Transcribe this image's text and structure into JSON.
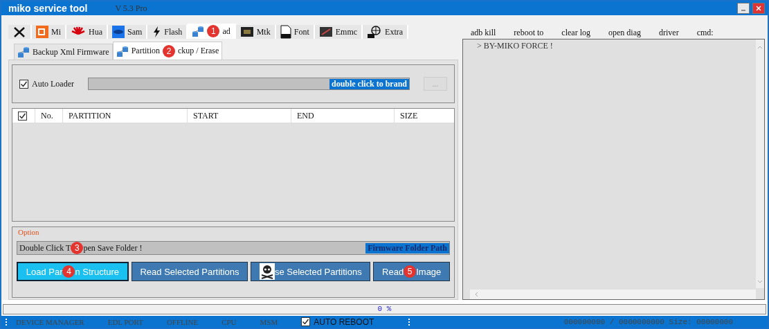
{
  "window": {
    "title": "miko service tool",
    "version": "V 5.3 Pro"
  },
  "main_tabs": [
    {
      "selected": false
    },
    {
      "parts": [
        {
          "text": "Mi"
        }
      ],
      "selected": false
    },
    {
      "parts": [
        {
          "text": "Hua"
        }
      ],
      "selected": false
    },
    {
      "parts": [
        {
          "text": "Sam"
        }
      ],
      "selected": false
    },
    {
      "parts": [
        {
          "text": "Flash"
        }
      ],
      "selected": false
    },
    {
      "parts": [
        {
          "marker": "1"
        },
        {
          "text": "ad"
        }
      ],
      "selected": true
    },
    {
      "parts": [
        {
          "text": "Mtk"
        }
      ],
      "selected": false
    },
    {
      "parts": [
        {
          "text": "Font"
        }
      ],
      "selected": false
    },
    {
      "parts": [
        {
          "text": "Emmc"
        }
      ],
      "selected": false
    },
    {
      "parts": [
        {
          "text": "Extra"
        }
      ],
      "selected": false
    }
  ],
  "sub_tabs": [
    {
      "parts": [
        {
          "text": "Backup Xml Firmware"
        }
      ],
      "selected": false
    },
    {
      "parts": [
        {
          "text": "Partition"
        },
        {
          "marker": "2"
        },
        {
          "text": "ckup / Erase"
        }
      ],
      "selected": true
    }
  ],
  "loader": {
    "label": "Auto Loader",
    "checked": true,
    "hint": "double click to brand",
    "browse": "...",
    "browse_disabled": true
  },
  "table": {
    "header_checked": true,
    "columns": [
      "No.",
      "PARTITION",
      "START",
      "END",
      "SIZE"
    ]
  },
  "option": {
    "legend": "Option",
    "path_parts": [
      {
        "text": "Double Click T"
      },
      {
        "marker": "3"
      },
      {
        "text": "pen Save Folder !"
      }
    ],
    "path_hint": "Firmware Folder Path"
  },
  "buttons": [
    {
      "parts": [
        {
          "text": "Load Par"
        },
        {
          "marker": "4"
        },
        {
          "text": "n Structure"
        }
      ],
      "selected": true
    },
    {
      "parts": [
        {
          "text": "Read Selected Partitions"
        }
      ],
      "selected": false
    },
    {
      "parts": [
        {
          "text": "se Selected Partitions"
        }
      ],
      "selected": false
    },
    {
      "parts": [
        {
          "text": "Read"
        },
        {
          "marker": "5"
        },
        {
          "text": "Image"
        }
      ],
      "selected": false
    }
  ],
  "log_toolbar": [
    "adb kill",
    "reboot to",
    "clear log",
    "open diag",
    "driver",
    "cmd:"
  ],
  "log": [
    "> BY-MIKO FORCE !"
  ],
  "progress": {
    "text": "0 %",
    "level": 0
  },
  "status_bar": {
    "items": [
      "DEVICE MANAGER",
      "EDL PORT",
      "OFFLINE",
      "CPU",
      "MSM"
    ],
    "auto_reboot": {
      "label": "AUTO REBOOT",
      "checked": true
    },
    "size": "000000000 / 0000000000 Size: 00000000"
  }
}
